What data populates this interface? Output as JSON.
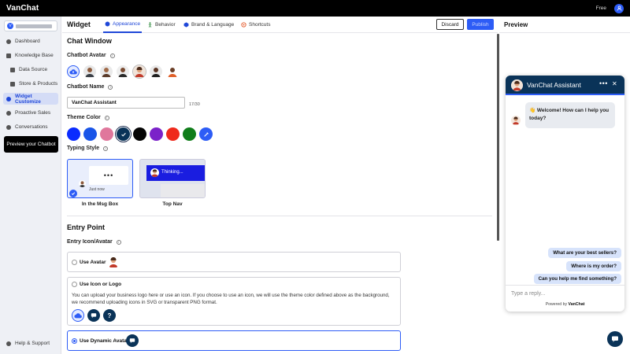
{
  "topbar": {
    "logo": "VanChat",
    "plan": "Free"
  },
  "sidebar": {
    "workspace_initial": "V",
    "items": [
      {
        "label": "Dashboard"
      },
      {
        "label": "Knowledge Base"
      },
      {
        "label": "Data Source"
      },
      {
        "label": "Store & Products"
      },
      {
        "label": "Widget Customize"
      },
      {
        "label": "Proactive Sales"
      },
      {
        "label": "Conversations"
      }
    ],
    "preview_button": "Preview your Chatbot",
    "help": "Help & Support"
  },
  "header": {
    "title": "Widget",
    "tabs": [
      {
        "label": "Appearance",
        "color": "#1f47d8"
      },
      {
        "label": "Behavior",
        "color": "#2e8b3d"
      },
      {
        "label": "Brand & Language",
        "color": "#1f47d8"
      },
      {
        "label": "Shortcuts",
        "color": "#e55a2b"
      }
    ],
    "discard": "Discard",
    "publish": "Publish"
  },
  "chat_window": {
    "section_title": "Chat Window",
    "avatar_label": "Chatbot Avatar",
    "name_label": "Chatbot Name",
    "name_value": "VanChat Assistant",
    "name_count": "17/30",
    "theme_label": "Theme Color",
    "theme_colors": [
      "#0a2bff",
      "#1a55e8",
      "#e0779c",
      "#0a3358",
      "#050505",
      "#7b22c9",
      "#ef2a1c",
      "#0f7d1a",
      "#2d5cf6"
    ],
    "typing_label": "Typing Style",
    "typing_styles": [
      {
        "label": "In the Msg Box",
        "time": "Just now"
      },
      {
        "label": "Top Nav",
        "thinking": "Thinking..."
      }
    ]
  },
  "entry_point": {
    "section_title": "Entry Point",
    "icon_label": "Entry Icon/Avatar",
    "options": [
      {
        "label": "Use Avatar"
      },
      {
        "label": "Use Icon or Logo",
        "desc": "You can upload your business logo here or use an icon. If you choose to use an icon, we will use the theme color defined above as the background, we recommend uploading icons in SVG or transparent PNG format."
      },
      {
        "label": "Use Dynamic Avatar"
      }
    ]
  },
  "preview": {
    "title": "Preview",
    "chat_title": "VanChat Assistant",
    "more": "•••",
    "close": "✕",
    "welcome": "👋 Welcome! How can I help you today?",
    "quick_replies": [
      "What are your best sellers?",
      "Where is my order?",
      "Can you help me find something?"
    ],
    "input_placeholder": "Type a reply...",
    "powered_prefix": "Powered by",
    "powered_brand": "VanChat"
  },
  "colors": {
    "accent": "#2d5cf6",
    "navy": "#0a3358"
  }
}
